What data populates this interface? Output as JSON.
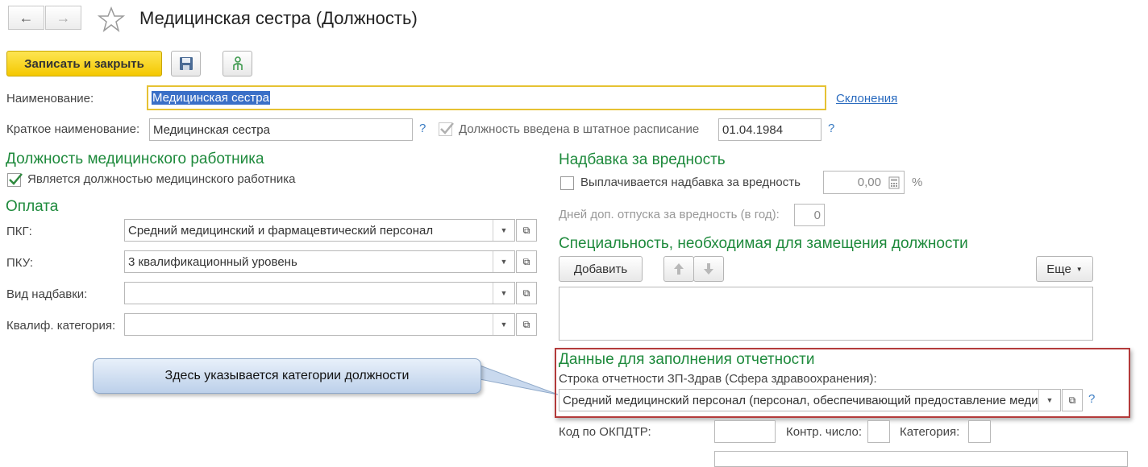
{
  "window": {
    "title": "Медицинская сестра (Должность)"
  },
  "toolbar": {
    "save_close_label": "Записать и закрыть"
  },
  "name": {
    "label": "Наименование:",
    "value": "Медицинская сестра",
    "declensions_link": "Склонения"
  },
  "short_name": {
    "label": "Краткое наименование:",
    "value": "Медицинская сестра",
    "help": "?"
  },
  "staff_schedule": {
    "label": "Должность введена в штатное расписание",
    "checked": true,
    "date": "01.04.1984",
    "help": "?"
  },
  "medical": {
    "heading": "Должность медицинского работника",
    "checkbox_label": "Является должностью медицинского работника",
    "checked": true
  },
  "payment": {
    "heading": "Оплата",
    "pkg_label": "ПКГ:",
    "pkg_value": "Средний медицинский и фармацевтический персонал",
    "pku_label": "ПКУ:",
    "pku_value": "3 квалификационный уровень",
    "allowance_type_label": "Вид надбавки:",
    "allowance_type_value": "",
    "qual_category_label": "Квалиф. категория:",
    "qual_category_value": ""
  },
  "hazard": {
    "heading": "Надбавка за вредность",
    "checkbox_label": "Выплачивается надбавка за вредность",
    "checked": false,
    "amount": "0,00",
    "percent": "%",
    "days_label": "Дней доп. отпуска за вредность (в год):",
    "days_value": "0"
  },
  "specialty": {
    "heading": "Специальность, необходимая для замещения должности",
    "add_label": "Добавить",
    "more_label": "Еще"
  },
  "report": {
    "heading": "Данные для заполнения отчетности",
    "row_label": "Строка отчетности ЗП-Здрав (Сфера здравоохранения):",
    "row_value": "Средний медицинский персонал (персонал, обеспечивающий предоставление медицинских услуг)",
    "help": "?"
  },
  "okpdtr": {
    "label": "Код по ОКПДТР:",
    "value": "",
    "control_label": "Контр. число:",
    "control_value": "",
    "category_label": "Категория:",
    "category_value": ""
  },
  "callout": {
    "text": "Здесь указывается категории должности"
  },
  "colors": {
    "accent_yellow": "#f4c800",
    "heading_green": "#1e8a3c",
    "link_blue": "#3a7cc3",
    "highlight_red": "#b33a3a"
  }
}
